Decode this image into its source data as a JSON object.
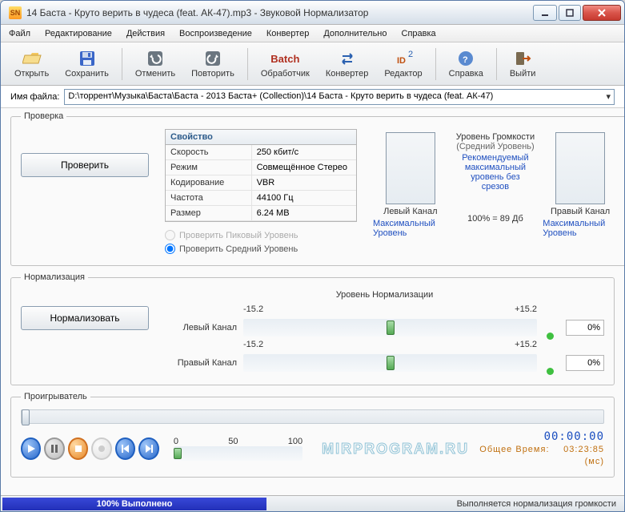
{
  "window": {
    "title": "14 Баста - Круто верить в чудеса (feat. АК-47).mp3 - Звуковой Нормализатор"
  },
  "menu": {
    "file": "Файл",
    "edit": "Редактирование",
    "actions": "Действия",
    "playback": "Воспроизведение",
    "converter": "Конвертер",
    "extra": "Дополнительно",
    "help": "Справка"
  },
  "toolbar": {
    "open": "Открыть",
    "save": "Сохранить",
    "undo": "Отменить",
    "redo": "Повторить",
    "batch_top": "Batch",
    "batch": "Обработчик",
    "converter": "Конвертер",
    "editor": "Редактор",
    "help": "Справка",
    "exit": "Выйти"
  },
  "filebar": {
    "label": "Имя файла:",
    "path": "D:\\торрент\\Музыка\\Баста\\Баста - 2013 Баста+ (Collection)\\14 Баста - Круто верить в чудеса (feat. АК-47)"
  },
  "check": {
    "legend": "Проверка",
    "button": "Проверить",
    "prop_header": "Свойство",
    "rows": {
      "speed_k": "Скорость",
      "speed_v": "250 кбит/с",
      "mode_k": "Режим",
      "mode_v": "Совмещённое Стерео",
      "enc_k": "Кодирование",
      "enc_v": "VBR",
      "freq_k": "Частота",
      "freq_v": "44100 Гц",
      "size_k": "Размер",
      "size_v": "6.24 МВ"
    },
    "radio_peak": "Проверить Пиковый Уровень",
    "radio_avg": "Проверить Средний Уровень",
    "left_ch": "Левый Канал",
    "right_ch": "Правый Канал",
    "max_level": "Максимальный Уровень",
    "vol_level": "Уровень Громкости",
    "avg_level": "(Средний Уровень)",
    "recommend": "Рекомендуемый максимальный уровень без срезов",
    "percent": "100%  =  89 Дб"
  },
  "norm": {
    "legend": "Нормализация",
    "button": "Нормализовать",
    "title": "Уровень Нормализации",
    "left": "Левый Канал",
    "right": "Правый Канал",
    "min": "-15.2",
    "max": "+15.2",
    "pct": "0%"
  },
  "player": {
    "legend": "Проигрыватель",
    "t0": "0",
    "t50": "50",
    "t100": "100",
    "time1": "00:00:00",
    "time2_label": "Общее Время:",
    "time2": "03:23:85 (мс)",
    "watermark": "MIRPROGRAM.RU"
  },
  "status": {
    "progress": "100% Выполнено",
    "text": "Выполняется нормализация громкости"
  }
}
